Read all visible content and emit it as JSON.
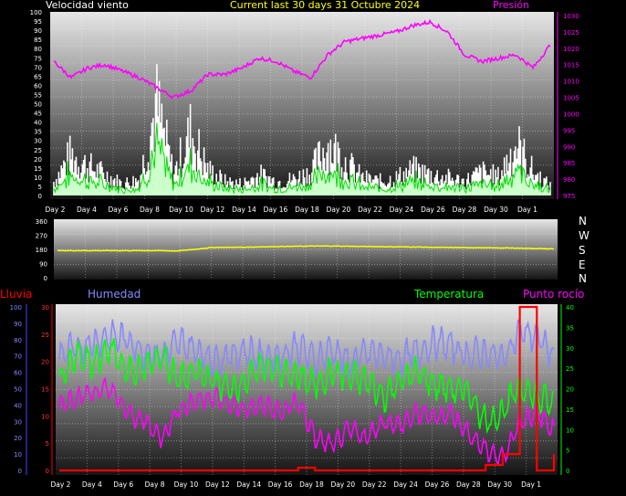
{
  "header": {
    "wind_label": "Velocidad viento",
    "period_label": "Current last 30 days 31 Octubre 2024",
    "pressure_label": "Presión"
  },
  "lower_header": {
    "rain_label": "Lluvia",
    "humidity_label": "Humedad",
    "temperature_label": "Temperatura",
    "dewpoint_label": "Punto rocío"
  },
  "direction_labels": [
    "N",
    "W",
    "S",
    "E",
    "N"
  ],
  "colors": {
    "wind": "#ffffff",
    "gust_fill": "#ccffcc",
    "gust_line": "#00dd00",
    "pressure": "#ff00ff",
    "direction": "#ffff00",
    "humidity": "#8888ff",
    "temperature": "#00ff00",
    "dewpoint": "#ff00ff",
    "rain": "#ff0000"
  },
  "chart_data": [
    {
      "type": "line",
      "title": "Current last 30 days 31 Octubre 2024",
      "x_tick_labels": [
        "Day 2",
        "Day 4",
        "Day 6",
        "Day 8",
        "Day 10",
        "Day 12",
        "Day 14",
        "Day 16",
        "Day 18",
        "Day 20",
        "Day 22",
        "Day 24",
        "Day 26",
        "Day 28",
        "Day 30",
        "Day 1"
      ],
      "x": [
        2,
        3,
        4,
        5,
        6,
        7,
        8,
        9,
        10,
        11,
        12,
        13,
        14,
        15,
        16,
        17,
        18,
        19,
        20,
        21,
        22,
        23,
        24,
        25,
        26,
        27,
        28,
        29,
        30,
        31
      ],
      "y_left_ticks": [
        "0",
        "5",
        "10",
        "15",
        "20",
        "25",
        "30",
        "35",
        "40",
        "45",
        "50",
        "55",
        "60",
        "65",
        "70",
        "75",
        "80",
        "85",
        "90",
        "95",
        "100"
      ],
      "y_left_range": [
        0,
        100
      ],
      "y_right_ticks": [
        "975",
        "980",
        "985",
        "990",
        "995",
        "1000",
        "1005",
        "1010",
        "1015",
        "1020",
        "1025",
        "1030"
      ],
      "y_right_range": [
        975,
        1030
      ],
      "series": [
        {
          "name": "Velocidad viento",
          "axis": "left",
          "values": [
            12,
            35,
            25,
            18,
            10,
            14,
            78,
            18,
            55,
            22,
            12,
            10,
            18,
            12,
            14,
            20,
            45,
            30,
            15,
            12,
            15,
            22,
            18,
            15,
            12,
            20,
            16,
            45,
            20,
            8
          ]
        },
        {
          "name": "Presión",
          "axis": "right",
          "values": [
            1016,
            1011,
            1014,
            1015,
            1013,
            1011,
            1008,
            1005,
            1007,
            1012,
            1012,
            1014,
            1017,
            1016,
            1013,
            1011,
            1018,
            1022,
            1023,
            1024,
            1025,
            1027,
            1028,
            1025,
            1018,
            1016,
            1017,
            1018,
            1014,
            1021
          ]
        }
      ]
    },
    {
      "type": "line",
      "x_tick_labels": [
        "Day 2",
        "Day 4",
        "Day 6",
        "Day 8",
        "Day 10",
        "Day 12",
        "Day 14",
        "Day 16",
        "Day 18",
        "Day 20",
        "Day 22",
        "Day 24",
        "Day 26",
        "Day 28",
        "Day 30",
        "Day 1"
      ],
      "x": [
        2,
        3,
        4,
        5,
        6,
        7,
        8,
        9,
        10,
        11,
        12,
        13,
        14,
        15,
        16,
        17,
        18,
        19,
        20,
        21,
        22,
        23,
        24,
        25,
        26,
        27,
        28,
        29,
        30,
        31
      ],
      "y_ticks": [
        "0",
        "90",
        "180",
        "270",
        "360"
      ],
      "y_range": [
        0,
        360
      ],
      "series": [
        {
          "name": "Dirección",
          "values": [
            172,
            172,
            172,
            172,
            172,
            172,
            172,
            170,
            180,
            192,
            193,
            194,
            196,
            198,
            200,
            201,
            201,
            200,
            198,
            197,
            196,
            195,
            193,
            192,
            191,
            190,
            189,
            188,
            185,
            183
          ]
        }
      ]
    },
    {
      "type": "line",
      "x_tick_labels": [
        "Day 2",
        "Day 4",
        "Day 6",
        "Day 8",
        "Day 10",
        "Day 12",
        "Day 14",
        "Day 16",
        "Day 18",
        "Day 20",
        "Day 22",
        "Day 24",
        "Day 26",
        "Day 28",
        "Day 30",
        "Day 1"
      ],
      "x": [
        2,
        3,
        4,
        5,
        6,
        7,
        8,
        9,
        10,
        11,
        12,
        13,
        14,
        15,
        16,
        17,
        18,
        19,
        20,
        21,
        22,
        23,
        24,
        25,
        26,
        27,
        28,
        29,
        30,
        31
      ],
      "y_rain_ticks": [
        "0",
        "5",
        "10",
        "15",
        "20",
        "25",
        "30"
      ],
      "y_rain_range": [
        0,
        30
      ],
      "y_humidity_ticks": [
        "0",
        "10",
        "20",
        "30",
        "40",
        "50",
        "60",
        "70",
        "80",
        "90",
        "100"
      ],
      "y_humidity_range": [
        0,
        100
      ],
      "y_temp_ticks": [
        "0",
        "5",
        "10",
        "15",
        "20",
        "25",
        "30",
        "35",
        "40"
      ],
      "y_temp_range": [
        0,
        40
      ],
      "series": [
        {
          "name": "Lluvia",
          "axis": "rain",
          "values": [
            0,
            0,
            0,
            0,
            0,
            0,
            0,
            0,
            0,
            0,
            0,
            0,
            0,
            0,
            0.5,
            0,
            0,
            0,
            0,
            0,
            0,
            0,
            0,
            0,
            0,
            1,
            3,
            30,
            0,
            3
          ]
        },
        {
          "name": "Humedad",
          "axis": "humidity",
          "values": [
            70,
            75,
            78,
            82,
            80,
            72,
            70,
            78,
            74,
            68,
            70,
            73,
            68,
            70,
            76,
            67,
            74,
            65,
            72,
            70,
            68,
            72,
            78,
            76,
            70,
            72,
            68,
            85,
            82,
            70
          ]
        },
        {
          "name": "Temperatura",
          "axis": "temp",
          "values": [
            22,
            28,
            26,
            30,
            24,
            25,
            28,
            22,
            24,
            22,
            20,
            22,
            26,
            24,
            23,
            21,
            24,
            23,
            22,
            18,
            22,
            24,
            21,
            20,
            19,
            12,
            14,
            21,
            18,
            16
          ]
        },
        {
          "name": "Punto rocío",
          "axis": "temp",
          "values": [
            16,
            18,
            19,
            20,
            14,
            12,
            8,
            15,
            17,
            18,
            16,
            15,
            16,
            14,
            17,
            8,
            6,
            10,
            8,
            12,
            11,
            14,
            13,
            14,
            9,
            5,
            3,
            12,
            14,
            10
          ]
        }
      ]
    }
  ]
}
